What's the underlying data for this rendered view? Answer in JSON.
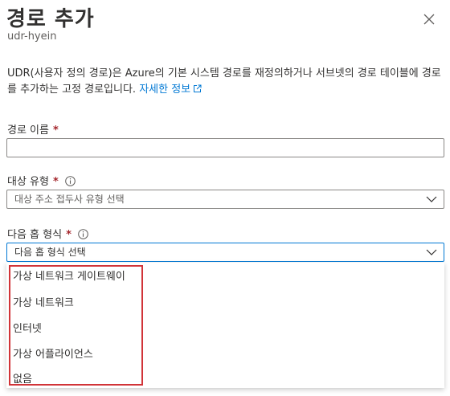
{
  "panel": {
    "title": "경로 추가",
    "subtitle": "udr-hyein",
    "description": "UDR(사용자 정의 경로)은 Azure의 기본 시스템 경로를 재정의하거나 서브넷의 경로 테이블에 경로를 추가하는 고정 경로입니다.",
    "learn_more": "자세한 정보"
  },
  "route_name": {
    "label": "경로 이름",
    "required_mark": "*",
    "value": ""
  },
  "destination_type": {
    "label": "대상 유형",
    "required_mark": "*",
    "selected": "대상 주소 접두사 유형 선택"
  },
  "next_hop_type": {
    "label": "다음 홉 형식",
    "required_mark": "*",
    "selected": "다음 홉 형식 선택",
    "options": [
      "가상 네트워크 게이트웨이",
      "가상 네트워크",
      "인터넷",
      "가상 어플라이언스",
      "없음"
    ]
  },
  "colors": {
    "accent": "#0078d4",
    "required": "#a4262c",
    "highlight_border": "#d13438"
  },
  "icons": {
    "close": "close-icon",
    "info": "info-icon",
    "external_link": "external-link-icon",
    "chevron": "chevron-down-icon"
  }
}
